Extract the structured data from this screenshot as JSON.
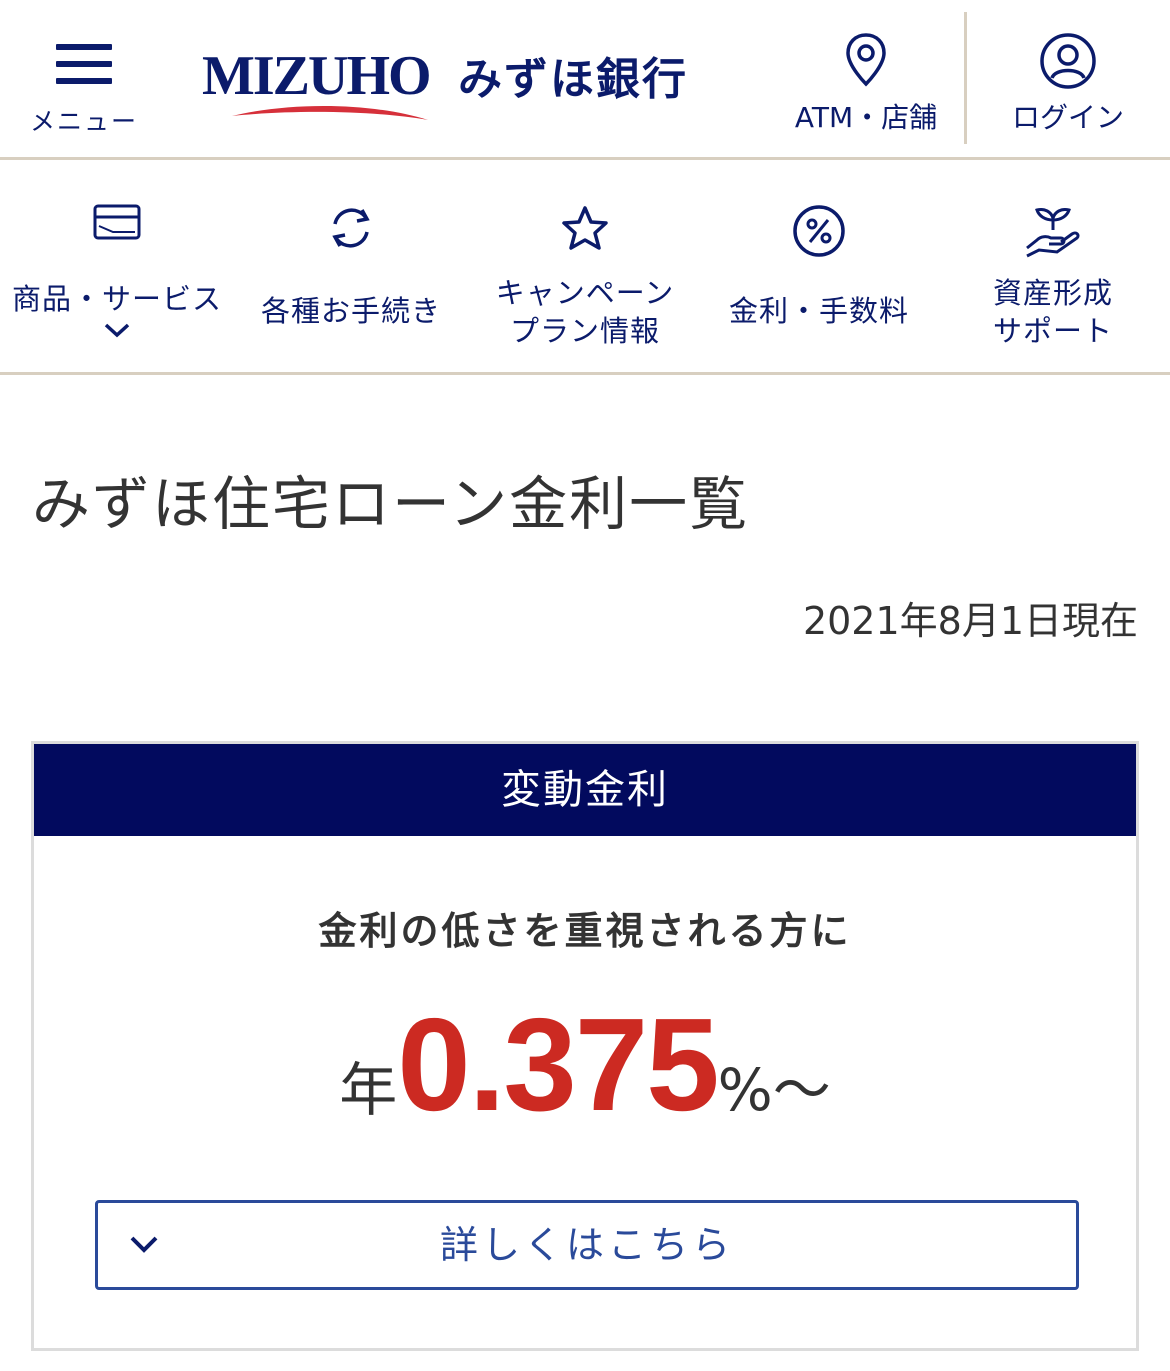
{
  "header": {
    "menu_label": "メニュー",
    "logo_text": "MIZUHO",
    "bank_name": "みずほ銀行",
    "atm_label": "ATM・店舗",
    "login_label": "ログイン"
  },
  "category_nav": {
    "items": [
      {
        "label": "商品・サービス",
        "icon": "card-icon"
      },
      {
        "label": "各種お手続き",
        "icon": "refresh-icon"
      },
      {
        "label_line1": "キャンペーン",
        "label_line2": "プラン情報",
        "icon": "star-icon"
      },
      {
        "label": "金利・手数料",
        "icon": "percent-icon"
      },
      {
        "label_line1": "資産形成",
        "label_line2": "サポート",
        "icon": "hand-plant-icon"
      }
    ]
  },
  "main": {
    "title": "みずほ住宅ローン金利一覧",
    "as_of": "2021年8月1日現在",
    "card": {
      "header": "変動金利",
      "subtitle": "金利の低さを重視される方に",
      "rate_prefix": "年",
      "rate_value": "0.375",
      "rate_suffix": "%〜",
      "detail_button": "詳しくはこちら"
    }
  },
  "colors": {
    "brand_navy": "#0b1b6b",
    "card_header_bg": "#020a5e",
    "rate_red": "#cc2a22",
    "divider": "#d8cfc0"
  }
}
